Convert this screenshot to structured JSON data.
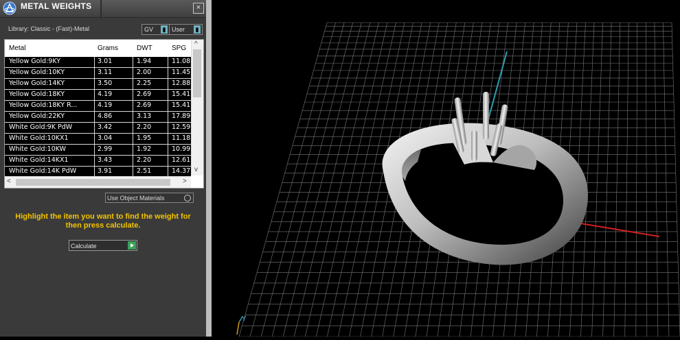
{
  "panel": {
    "title": "METAL WEIGHTS",
    "close_label": "×",
    "library_label": "Library: Classic - (Fast)-Metal",
    "gv_label": "GV",
    "user_label": "User",
    "columns": [
      "Metal",
      "Grams",
      "DWT",
      "SPG"
    ],
    "rows": [
      {
        "metal": "Yellow Gold:9KY",
        "grams": "3.01",
        "dwt": "1.94",
        "spg": "11.08"
      },
      {
        "metal": "Yellow Gold:10KY",
        "grams": "3.11",
        "dwt": "2.00",
        "spg": "11.45"
      },
      {
        "metal": "Yellow Gold:14KY",
        "grams": "3.50",
        "dwt": "2.25",
        "spg": "12.88"
      },
      {
        "metal": "Yellow Gold:18KY",
        "grams": "4.19",
        "dwt": "2.69",
        "spg": "15.41"
      },
      {
        "metal": "Yellow Gold:18KY R...",
        "grams": "4.19",
        "dwt": "2.69",
        "spg": "15.41"
      },
      {
        "metal": "Yellow Gold:22KY",
        "grams": "4.86",
        "dwt": "3.13",
        "spg": "17.89"
      },
      {
        "metal": "White Gold:9K PdW",
        "grams": "3.42",
        "dwt": "2.20",
        "spg": "12.59"
      },
      {
        "metal": "White Gold:10KX1",
        "grams": "3.04",
        "dwt": "1.95",
        "spg": "11.18"
      },
      {
        "metal": "White Gold:10KW",
        "grams": "2.99",
        "dwt": "1.92",
        "spg": "10.99"
      },
      {
        "metal": "White Gold:14KX1",
        "grams": "3.43",
        "dwt": "2.20",
        "spg": "12.61"
      },
      {
        "metal": "White Gold:14K PdW",
        "grams": "3.91",
        "dwt": "2.51",
        "spg": "14.37"
      }
    ],
    "use_object_materials_label": "Use Object Materials",
    "instruction": "Highlight the item you want to find the weight for then press calculate.",
    "calculate_label": "Calculate"
  },
  "viewport": {
    "axis_y_label": "Y",
    "colors": {
      "grid": "#7a7a7a",
      "x_axis": "#d62020",
      "y_axis": "#2aa0b0",
      "instruction_text": "#f2c400"
    }
  }
}
